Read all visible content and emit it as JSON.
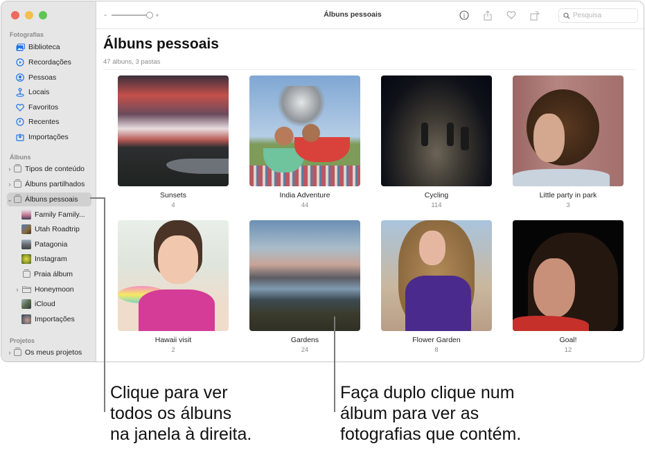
{
  "window": {
    "toolbar_title": "Álbuns pessoais",
    "search_placeholder": "Pesquisa"
  },
  "sidebar": {
    "sections": [
      {
        "label": "Fotografias",
        "items": [
          {
            "label": "Biblioteca",
            "icon": "library-icon"
          },
          {
            "label": "Recordações",
            "icon": "memories-icon"
          },
          {
            "label": "Pessoas",
            "icon": "people-icon"
          },
          {
            "label": "Locais",
            "icon": "places-icon"
          },
          {
            "label": "Favoritos",
            "icon": "heart-icon"
          },
          {
            "label": "Recentes",
            "icon": "clock-icon"
          },
          {
            "label": "Importações",
            "icon": "import-icon"
          }
        ]
      },
      {
        "label": "Álbuns",
        "items": [
          {
            "label": "Tipos de conteúdo",
            "icon": "album-stack-icon"
          },
          {
            "label": "Álbuns partilhados",
            "icon": "shared-album-icon"
          },
          {
            "label": "Álbuns pessoais",
            "icon": "album-stack-icon",
            "selected": true
          },
          {
            "label": "Family Family...",
            "icon": "album-thumbnail"
          },
          {
            "label": "Utah Roadtrip",
            "icon": "album-thumbnail"
          },
          {
            "label": "Patagonia",
            "icon": "album-thumbnail"
          },
          {
            "label": "Instagram",
            "icon": "album-thumbnail"
          },
          {
            "label": "Praia álbum",
            "icon": "album-stack-icon"
          },
          {
            "label": "Honeymoon",
            "icon": "folder-icon"
          },
          {
            "label": "iCloud",
            "icon": "album-thumbnail"
          },
          {
            "label": "Importações",
            "icon": "album-thumbnail"
          }
        ]
      },
      {
        "label": "Projetos",
        "items": [
          {
            "label": "Os meus projetos",
            "icon": "album-stack-icon"
          }
        ]
      }
    ]
  },
  "main": {
    "title": "Álbuns pessoais",
    "subtitle": "47 álbuns, 3 pastas",
    "albums": [
      {
        "name": "Sunsets",
        "count": "4"
      },
      {
        "name": "India Adventure",
        "count": "44"
      },
      {
        "name": "Cycling",
        "count": "114"
      },
      {
        "name": "Little party in park",
        "count": "3"
      },
      {
        "name": "Hawaii visit",
        "count": "2"
      },
      {
        "name": "Gardens",
        "count": "24"
      },
      {
        "name": "Flower Garden",
        "count": "8"
      },
      {
        "name": "Goal!",
        "count": "12"
      }
    ]
  },
  "callouts": {
    "left": [
      "Clique para ver",
      "todos os álbuns",
      "na janela à direita."
    ],
    "right": [
      "Faça duplo clique num",
      "álbum para ver as",
      "fotografias que contém."
    ]
  },
  "colors": {
    "accent": "#1a73e8",
    "traffic_close": "#ed6a5e",
    "traffic_minimize": "#f5bf4f",
    "traffic_zoom": "#61c554"
  }
}
